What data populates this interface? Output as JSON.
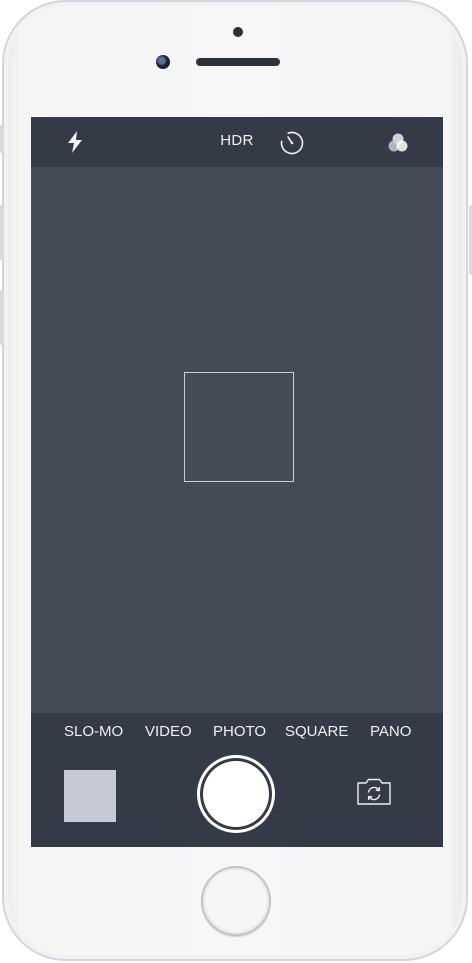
{
  "topbar": {
    "hdr_label": "HDR",
    "icons": [
      "flash-icon",
      "timer-icon",
      "filters-icon"
    ]
  },
  "modes": [
    "SLO-MO",
    "VIDEO",
    "PHOTO",
    "SQUARE",
    "PANO"
  ],
  "selected_mode": "PHOTO",
  "colors": {
    "viewfinder": "#454c57",
    "bars": "#343a46",
    "text": "#eef0f4",
    "thumbnail": "#c5cad6",
    "shutter": "#ffffff"
  },
  "controls": {
    "shutter": "shutter-button",
    "switch_camera": "camera-switch-icon",
    "last_photo": "photo-thumbnail"
  }
}
